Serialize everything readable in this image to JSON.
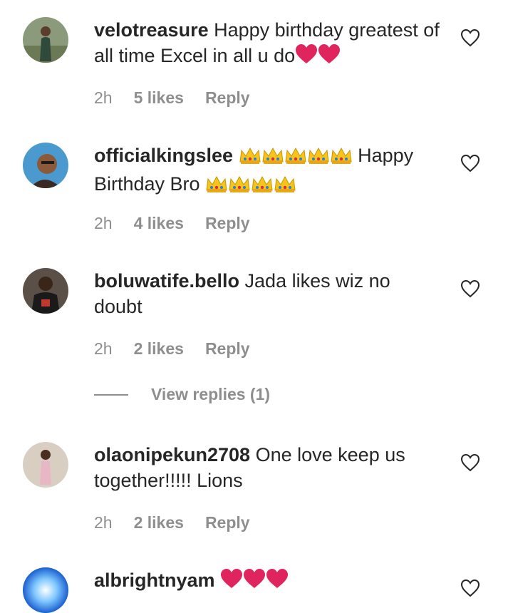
{
  "comments": [
    {
      "username": "velotreasure",
      "text": "Happy birthday greatest of all time Excel in all u do",
      "emoji_trail": [
        "heart",
        "heart"
      ],
      "time": "2h",
      "likes": "5 likes",
      "reply": "Reply"
    },
    {
      "username": "officialkingslee",
      "text_before": "Happy Birthday Bro",
      "time": "2h",
      "likes": "4 likes",
      "reply": "Reply"
    },
    {
      "username": "boluwatife.bello",
      "text": "Jada likes wiz no doubt",
      "time": "2h",
      "likes": "2 likes",
      "reply": "Reply"
    },
    {
      "username": "olaonipekun2708",
      "text": "One love keep us together!!!!! Lions",
      "time": "2h",
      "likes": "2 likes",
      "reply": "Reply"
    },
    {
      "username": "albrightnyam"
    }
  ],
  "view_replies": "View replies (1)",
  "colors": {
    "text": "#262626",
    "meta": "#8e8e8e",
    "heart_emoji": "#e0245e",
    "crown": "#f5c518"
  },
  "icons": {
    "like": "heart-outline-icon",
    "emoji_heart": "red-heart-emoji",
    "emoji_crown": "crown-emoji"
  }
}
